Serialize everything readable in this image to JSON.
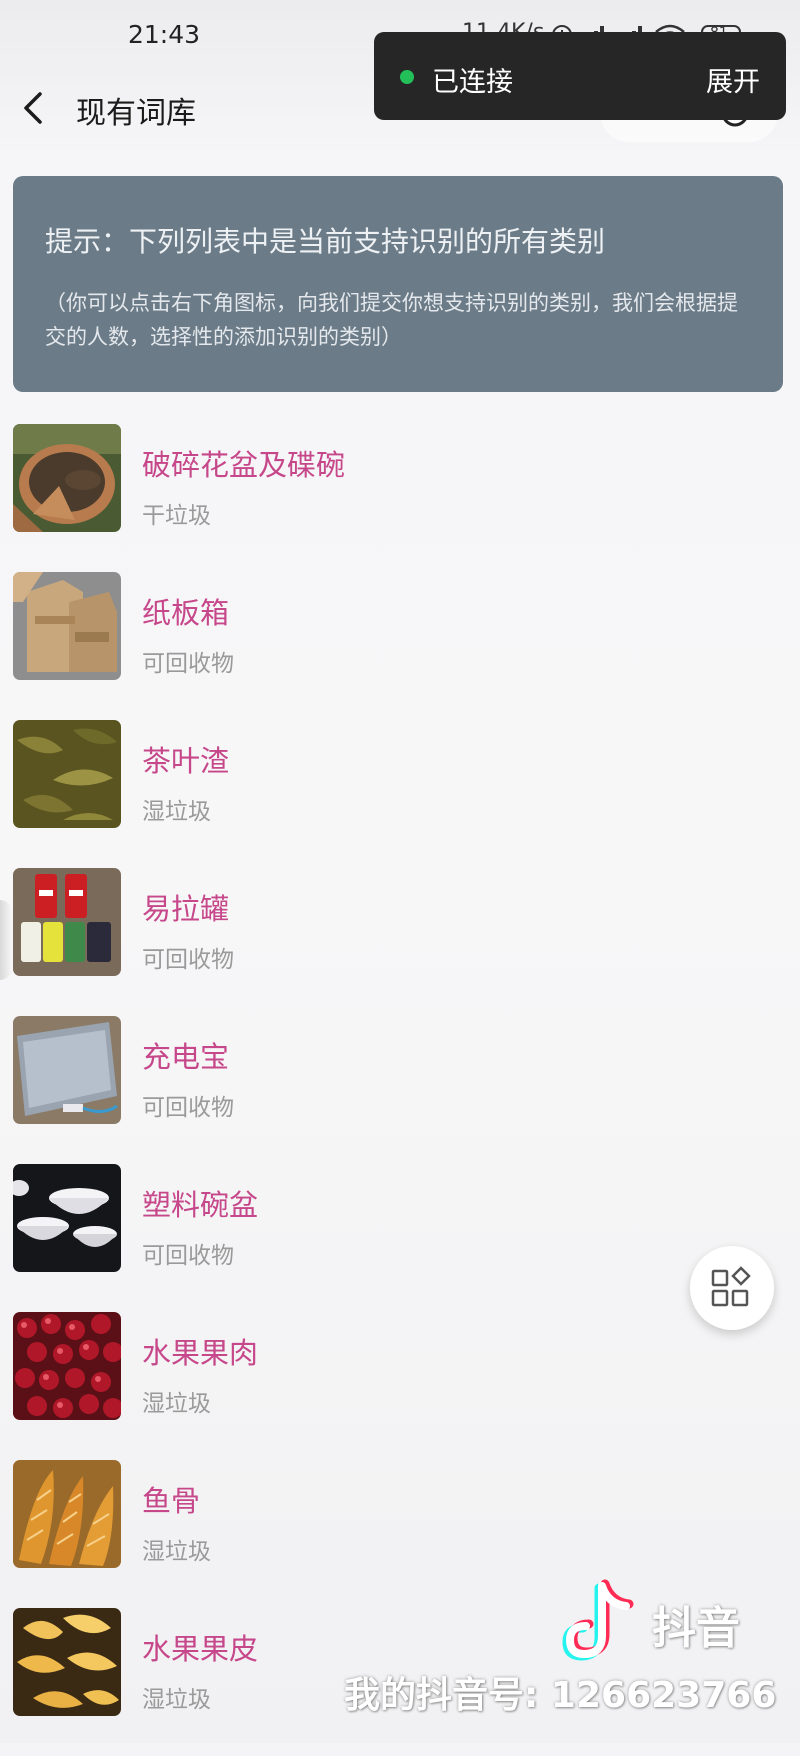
{
  "status_bar": {
    "time": "21:43",
    "network_speed": "11.4K/s",
    "battery": "81",
    "icons": [
      "alarm-icon",
      "signal-hd-icon",
      "signal-hd-icon",
      "wifi-icon",
      "battery-icon"
    ]
  },
  "nav": {
    "title": "现有词库",
    "back_icon": "back-arrow-icon",
    "capsule_menu": "•••"
  },
  "toast": {
    "status": "已连接",
    "action": "展开",
    "status_color": "#23c05a"
  },
  "tip": {
    "title": "提示：下列列表中是当前支持识别的所有类别",
    "description": "（你可以点击右下角图标，向我们提交你想支持识别的类别，我们会根据提交的人数，选择性的添加识别的类别）"
  },
  "items": [
    {
      "name": "破碎花盆及碟碗",
      "category": "干垃圾",
      "image": "broken-flowerpot"
    },
    {
      "name": "纸板箱",
      "category": "可回收物",
      "image": "cardboard-boxes"
    },
    {
      "name": "茶叶渣",
      "category": "湿垃圾",
      "image": "tea-leaves"
    },
    {
      "name": "易拉罐",
      "category": "可回收物",
      "image": "cans"
    },
    {
      "name": "充电宝",
      "category": "可回收物",
      "image": "power-bank"
    },
    {
      "name": "塑料碗盆",
      "category": "可回收物",
      "image": "plastic-bowls"
    },
    {
      "name": "水果果肉",
      "category": "湿垃圾",
      "image": "cherries"
    },
    {
      "name": "鱼骨",
      "category": "湿垃圾",
      "image": "fish-bones"
    },
    {
      "name": "水果果皮",
      "category": "湿垃圾",
      "image": "fruit-peel"
    }
  ],
  "fab": {
    "icon": "grid-apps-icon"
  },
  "watermark": {
    "brand": "抖音",
    "account": "我的抖音号: 126623766"
  },
  "colors": {
    "item_name": "#c6478a",
    "item_category": "#9a9a9a",
    "tip_background": "#6b7c88",
    "toast_background": "#262626"
  }
}
